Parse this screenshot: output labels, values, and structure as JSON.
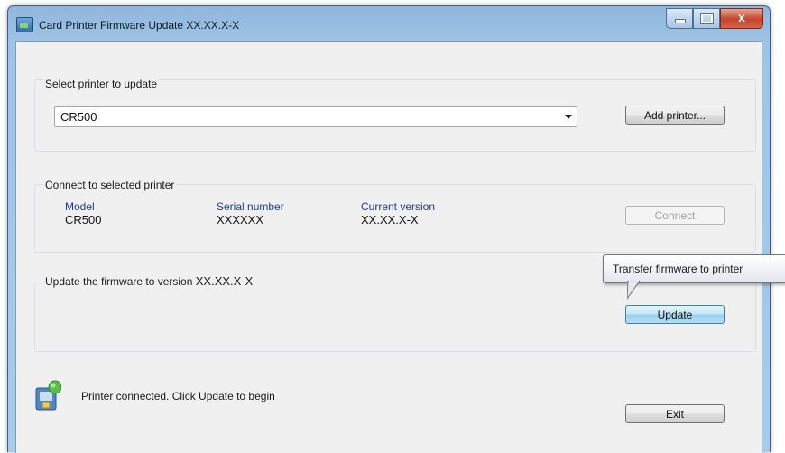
{
  "window": {
    "title": "Card Printer Firmware Update XX.XX.X-X",
    "minimize_icon": "minimize-icon",
    "maximize_icon": "maximize-icon",
    "close_glyph": "x"
  },
  "select_group": {
    "label": "Select printer to update",
    "printer_selected": "CR500",
    "add_printer_label": "Add printer..."
  },
  "connect_group": {
    "label": "Connect to selected printer",
    "model_label": "Model",
    "model_value": "CR500",
    "serial_label": "Serial number",
    "serial_value": "XXXXXX",
    "version_label": "Current version",
    "version_value": "XX.XX.X-X",
    "connect_label": "Connect"
  },
  "update_group": {
    "label_prefix": "Update the firmware to version",
    "label_version": "XX.XX.X-X",
    "update_label": "Update",
    "tooltip": "Transfer firmware to printer"
  },
  "status": {
    "message": "Printer connected. Click Update to begin",
    "icon": "printer-status-icon"
  },
  "footer": {
    "exit_label": "Exit"
  }
}
